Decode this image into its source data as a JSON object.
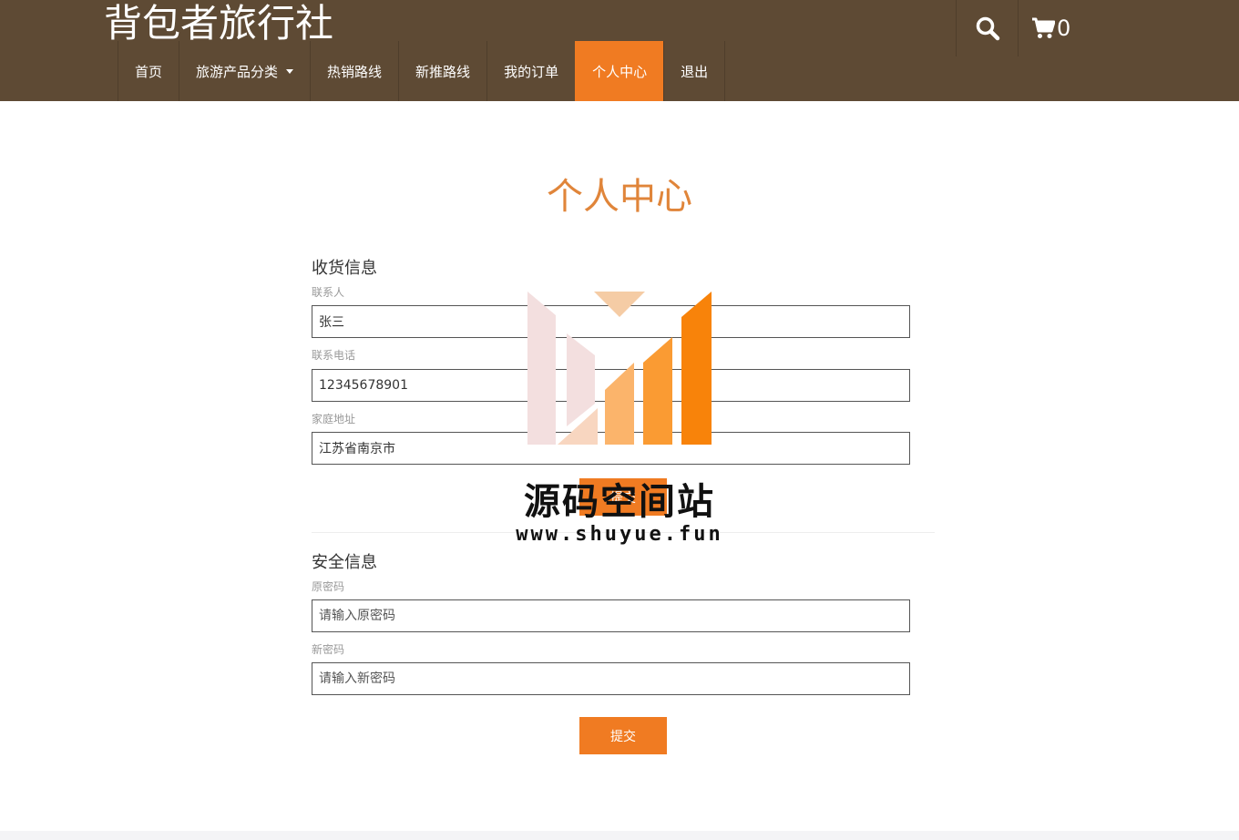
{
  "brand": "背包者旅行社",
  "nav": {
    "items": [
      "首页",
      "旅游产品分类",
      "热销路线",
      "新推路线",
      "我的订单",
      "个人中心",
      "退出"
    ],
    "active_index": 5
  },
  "cart": {
    "count": "0"
  },
  "page_title": "个人中心",
  "shipping": {
    "title": "收货信息",
    "contact": {
      "label": "联系人",
      "value": "张三"
    },
    "phone": {
      "label": "联系电话",
      "value": "12345678901"
    },
    "address": {
      "label": "家庭地址",
      "value": "江苏省南京市"
    },
    "submit_label": "提交"
  },
  "security": {
    "title": "安全信息",
    "old_password": {
      "label": "原密码",
      "placeholder": "请输入原密码"
    },
    "new_password": {
      "label": "新密码",
      "placeholder": "请输入新密码"
    },
    "submit_label": "提交"
  },
  "watermark": {
    "name": "源码空间站",
    "url": "www.shuyue.fun"
  },
  "colors": {
    "header": "#5e4a34",
    "accent": "#f07b22",
    "title": "#e0853a"
  },
  "icons": {
    "search": "search-icon",
    "cart": "cart-icon"
  }
}
